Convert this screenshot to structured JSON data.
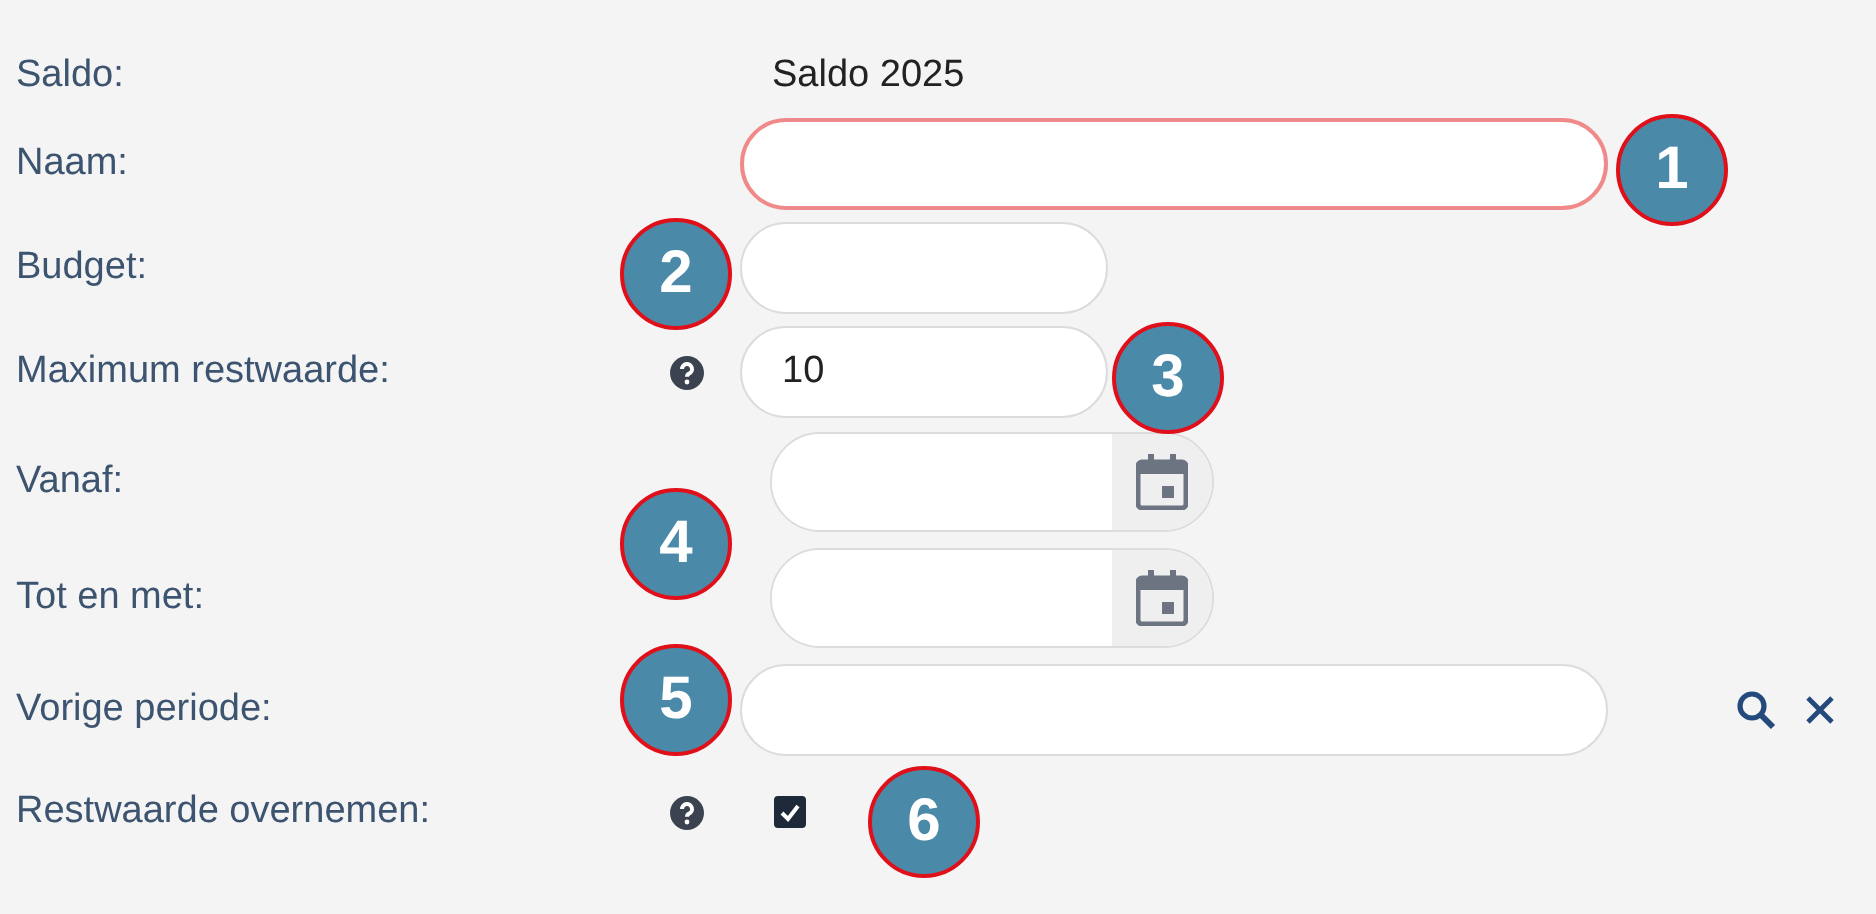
{
  "rows": [
    {
      "kind": "text",
      "label": "Saldo:",
      "help": false,
      "value": "Saldo 2025"
    },
    {
      "kind": "wide",
      "label": "Naam:",
      "help": false,
      "invalid": true
    },
    {
      "kind": "short",
      "label": "Budget:",
      "invalid": false
    },
    {
      "kind": "short",
      "label": "Maximum restwaarde:",
      "help": true,
      "invalid": false,
      "value": "10"
    },
    {
      "kind": "date",
      "label": "Vanaf:",
      "help": false
    },
    {
      "kind": "date",
      "label": "Tot en met:",
      "help": false
    },
    {
      "kind": "lookup",
      "label": "Vorige periode:"
    },
    {
      "kind": "checkbox",
      "label": "Restwaarde overnemen:",
      "help": true,
      "checked": true
    }
  ],
  "callouts": [
    {
      "number": "1"
    },
    {
      "number": "2"
    },
    {
      "number": "3"
    },
    {
      "number": "4"
    },
    {
      "number": "5"
    },
    {
      "number": "6"
    }
  ]
}
